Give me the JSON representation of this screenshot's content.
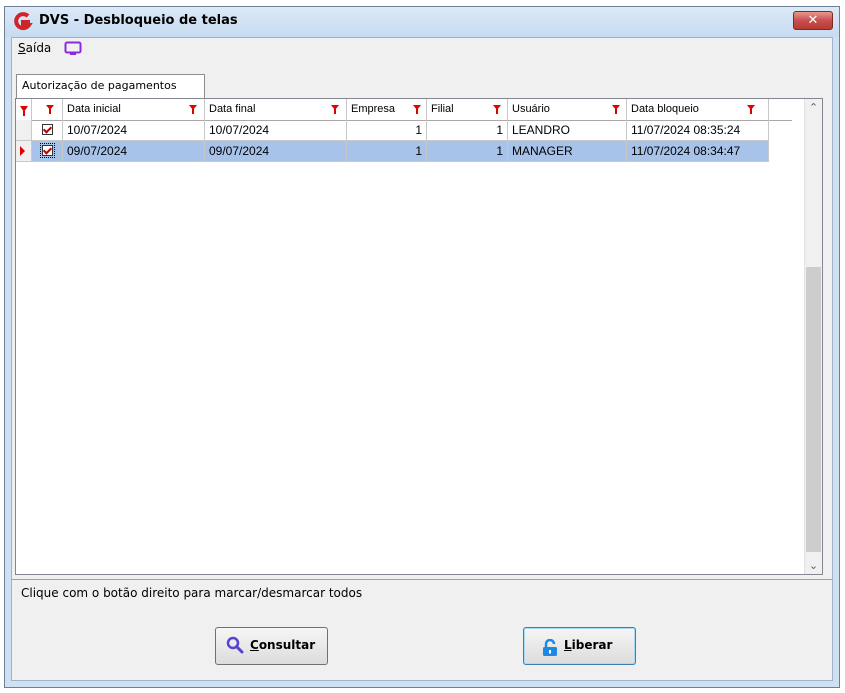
{
  "window": {
    "title": "DVS - Desbloqueio de telas",
    "close_label": "✕"
  },
  "menu": {
    "saida": {
      "accel": "S",
      "rest": "aída"
    }
  },
  "tabs": [
    {
      "label": "Autorização de pagamentos",
      "active": true
    }
  ],
  "grid": {
    "columns": [
      "Data inicial",
      "Data final",
      "Empresa",
      "Filial",
      "Usuário",
      "Data bloqueio"
    ],
    "rows": [
      {
        "checked": true,
        "data_inicial": "10/07/2024",
        "data_final": "10/07/2024",
        "empresa": "1",
        "filial": "1",
        "usuario": "LEANDRO",
        "data_bloqueio": "11/07/2024 08:35:24",
        "selected": false
      },
      {
        "checked": true,
        "data_inicial": "09/07/2024",
        "data_final": "09/07/2024",
        "empresa": "1",
        "filial": "1",
        "usuario": "MANAGER",
        "data_bloqueio": "11/07/2024 08:34:47",
        "selected": true
      }
    ]
  },
  "status_text": "Clique com o botão direito para marcar/desmarcar todos",
  "buttons": {
    "consultar": {
      "accel": "C",
      "rest": "onsultar"
    },
    "liberar": {
      "accel": "L",
      "rest": "iberar"
    }
  },
  "colors": {
    "accent_red": "#e00000",
    "selection": "#a7c3ea",
    "search_icon": "#5a3fd0",
    "lock_icon": "#1e88e5"
  }
}
